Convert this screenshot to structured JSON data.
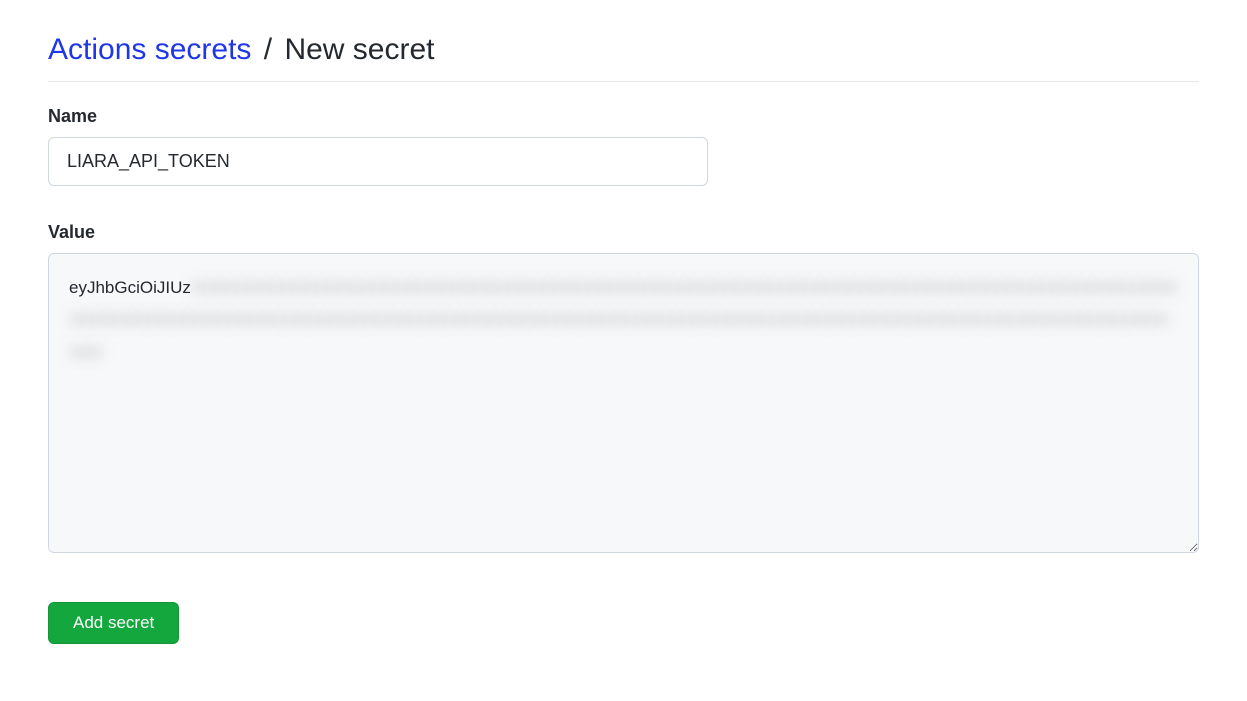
{
  "header": {
    "breadcrumb_link": "Actions secrets",
    "separator": "/",
    "current": "New secret"
  },
  "form": {
    "name_label": "Name",
    "name_value": "LIARA_API_TOKEN",
    "value_label": "Value",
    "value_visible_prefix": "eyJhbGciOiJIUz",
    "value_redacted_tail": "XXXXXXXXXXXXXXXXXXXXXXXXXXXXXXXXXXXXXXXXXXXXXXXXXXXXXXXXXXXXXXXXXXXXXXXXXXXXXXXXXXXXXXXXXXXXXXXXXXXXXXXXXXXXXXXXXXXXXXXXXXXXXXXXXXXXXXXXXXXXXXXXXXXXXXXXXXXXXXXXXXXXXXXXXXXXXXXXXXXXXXXXXXX"
  },
  "actions": {
    "submit_label": "Add secret"
  }
}
